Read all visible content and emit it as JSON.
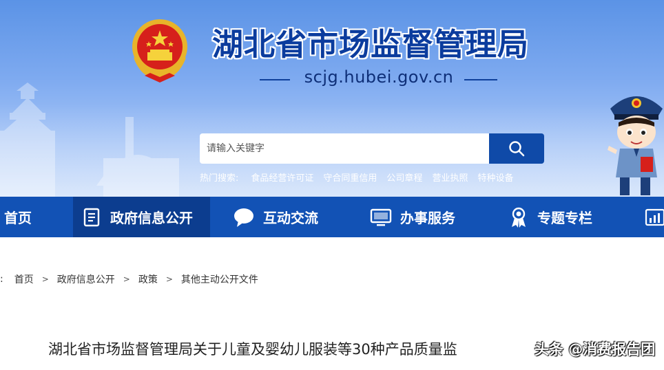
{
  "site": {
    "title": "湖北省市场监督管理局",
    "domain": "scjg.hubei.gov.cn"
  },
  "search": {
    "placeholder": "请输入关键字",
    "value": ""
  },
  "hot_search": {
    "label": "热门搜索:",
    "links": [
      "食品经营许可证",
      "守合同重信用",
      "公司章程",
      "营业执照",
      "特种设备"
    ]
  },
  "nav": {
    "items": [
      {
        "label": "首页",
        "icon": "home-icon"
      },
      {
        "label": "政府信息公开",
        "icon": "document-icon",
        "active": true
      },
      {
        "label": "互动交流",
        "icon": "chat-bubble-icon"
      },
      {
        "label": "办事服务",
        "icon": "monitor-icon"
      },
      {
        "label": "专题专栏",
        "icon": "award-ribbon-icon"
      },
      {
        "label": "",
        "icon": "bar-chart-icon"
      }
    ]
  },
  "breadcrumb": {
    "lead": ":",
    "separator": ">",
    "items": [
      "首页",
      "政府信息公开",
      "政策",
      "其他主动公开文件"
    ]
  },
  "article": {
    "title": "湖北省市场监督管理局关于儿童及婴幼儿服装等30种产品质量监",
    "watermark": "头条 @消费报告团"
  },
  "colors": {
    "nav_bg": "#1252b5",
    "nav_active_bg": "#0c3d8f",
    "title_blue": "#0b3c9e",
    "search_button": "#0f4aa8"
  }
}
